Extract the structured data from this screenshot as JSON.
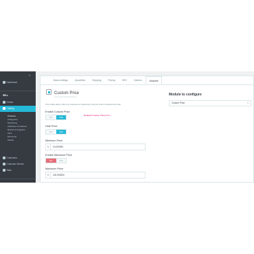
{
  "sidebar": {
    "dashboard": "Dashboard",
    "section": "SELL",
    "orders": "Orders",
    "catalog": "Catalog",
    "catalog_items": [
      "Products",
      "Categories",
      "Monitoring",
      "Attributes & Features",
      "Brands & Suppliers",
      "Files",
      "Discounts",
      "Stocks"
    ],
    "customers": "Customers",
    "customer_service": "Customer Service",
    "stats": "Stats"
  },
  "tabs": [
    "Basic settings",
    "Quantities",
    "Shipping",
    "Pricing",
    "SEO",
    "Options",
    "Modules"
  ],
  "active_tab": "Modules",
  "module": {
    "title": "Custom Price",
    "subtitle": "by ProgramacionPrestashop",
    "description": "This module allow to offer your customers an opportunity to pay the price for products they want.",
    "link": "Readjust Custom Price Form",
    "enable_custom_price": {
      "label": "Enable Custom Price",
      "no": "NO",
      "yes": "YES",
      "value": "YES"
    },
    "hide_price": {
      "label": "Hide Price",
      "no": "NO",
      "yes": "YES",
      "value": "YES"
    },
    "minimum_price": {
      "label": "Minimum Price",
      "currency": "$",
      "value": "10.000000"
    },
    "enable_maximum_price": {
      "label": "Enable Maximum Price",
      "no": "NO",
      "yes": "YES",
      "value": "NO"
    },
    "maximum_price": {
      "label": "Maximum Price",
      "currency": "$",
      "value": "100.000000"
    }
  },
  "configure": {
    "title": "Module to configure",
    "selected": "Custom Price"
  },
  "colors": {
    "accent": "#25b9d7",
    "sidebar": "#363a41",
    "danger": "#e76d7a",
    "link": "#df0067"
  }
}
